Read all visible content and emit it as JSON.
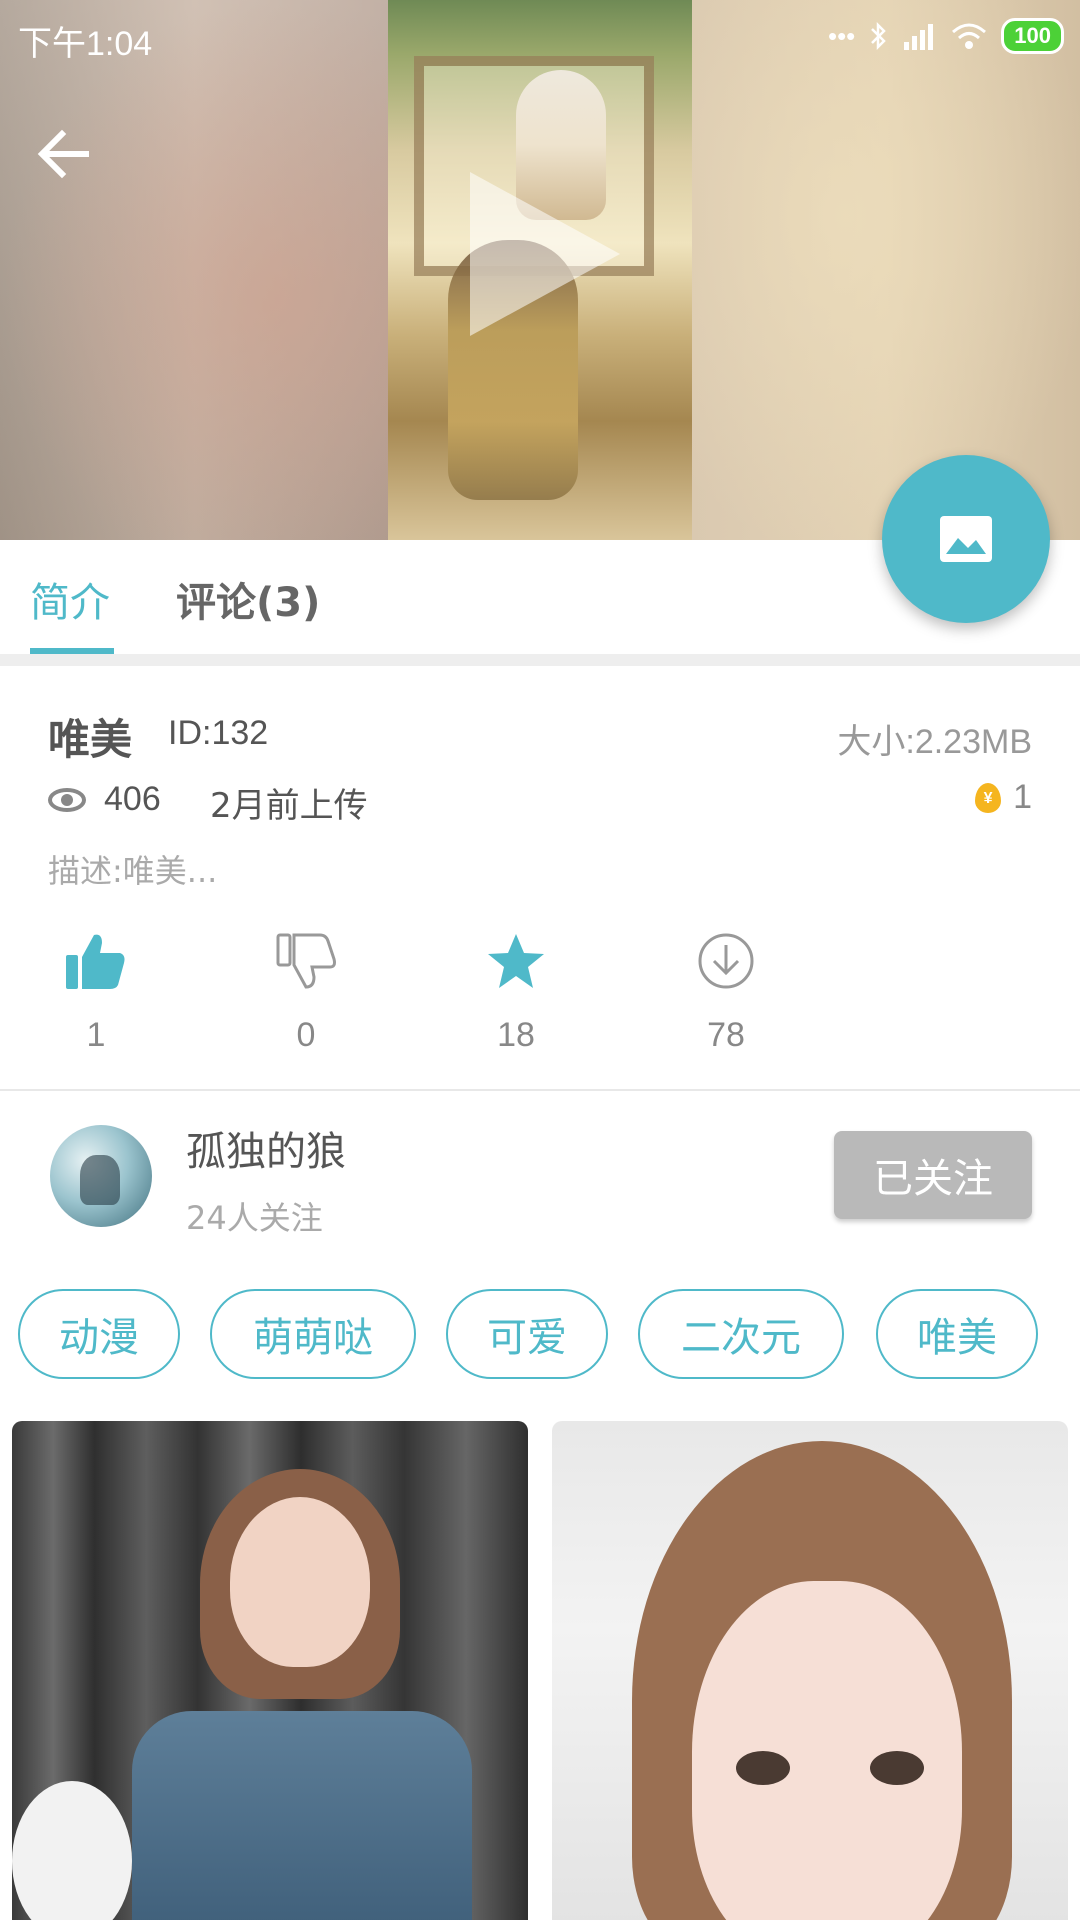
{
  "status_bar": {
    "time": "下午1:04",
    "signal_dots": "•••",
    "battery": "100"
  },
  "hero": {
    "icons": [
      "back-arrow-icon",
      "play-icon",
      "image-icon"
    ]
  },
  "tabs": [
    {
      "label": "简介",
      "active": true
    },
    {
      "label": "评论(3)",
      "active": false
    }
  ],
  "info": {
    "title": "唯美",
    "id": "ID:132",
    "size": "大小:2.23MB",
    "views": "406",
    "upload_time": "2月前上传",
    "coins": "1",
    "description": "描述:唯美..."
  },
  "actions": [
    {
      "name": "like",
      "icon": "thumbs-up-icon",
      "count": "1",
      "active": true
    },
    {
      "name": "dislike",
      "icon": "thumbs-down-icon",
      "count": "0",
      "active": false
    },
    {
      "name": "favorite",
      "icon": "star-icon",
      "count": "18",
      "active": true
    },
    {
      "name": "download",
      "icon": "download-icon",
      "count": "78",
      "active": false
    }
  ],
  "author": {
    "name": "孤独的狼",
    "followers": "24人关注",
    "follow_label": "已关注"
  },
  "tags": [
    "动漫",
    "萌萌哒",
    "可爱",
    "二次元",
    "唯美"
  ],
  "colors": {
    "accent": "#4fb9c9",
    "followed_button": "#b9b9b9",
    "coin": "#f5b51f"
  }
}
